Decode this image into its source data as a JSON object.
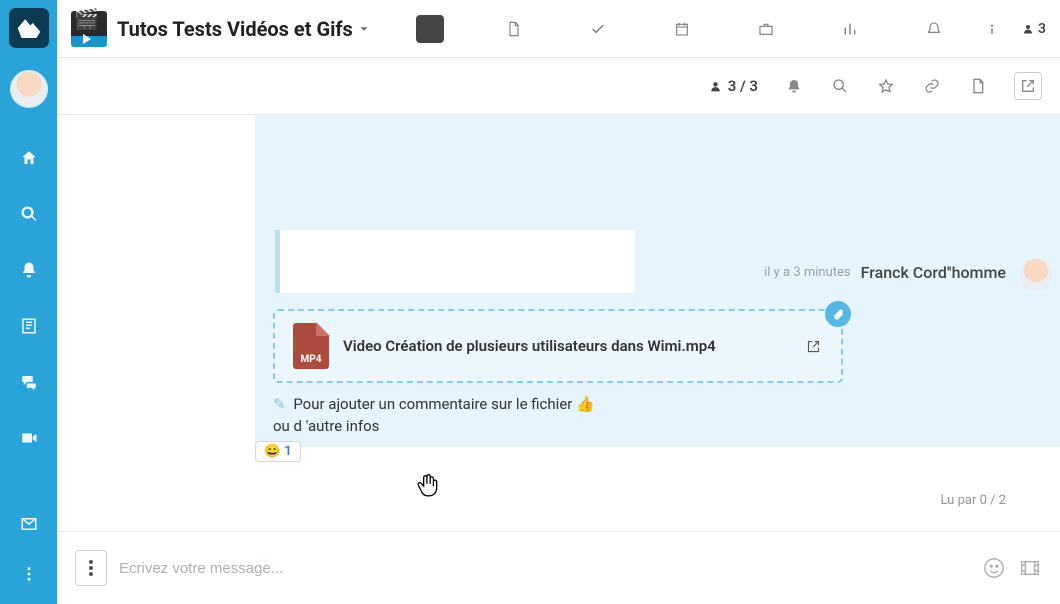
{
  "project": {
    "title": "Tutos Tests Vidéos et Gifs"
  },
  "topbar": {
    "user_count": "3"
  },
  "subbar": {
    "members": "3 / 3"
  },
  "messages": {
    "a": {
      "link": "https://www.wimi-teamwork.com/fr/"
    },
    "b": {
      "time": "il y a 3 minutes",
      "author": "Franck Cord''homme",
      "attachment": {
        "filename": "Video Création de plusieurs utilisateurs dans Wimi.mp4",
        "type_label": "MP4"
      },
      "text_line1": "Pour ajouter un commentaire sur le fichier 👍",
      "text_line2": "ou d 'autre infos"
    }
  },
  "reaction": {
    "emoji": "😄",
    "count": "1"
  },
  "readby": "Lu par 0 / 2",
  "composer": {
    "placeholder": "Ecrivez votre message..."
  }
}
